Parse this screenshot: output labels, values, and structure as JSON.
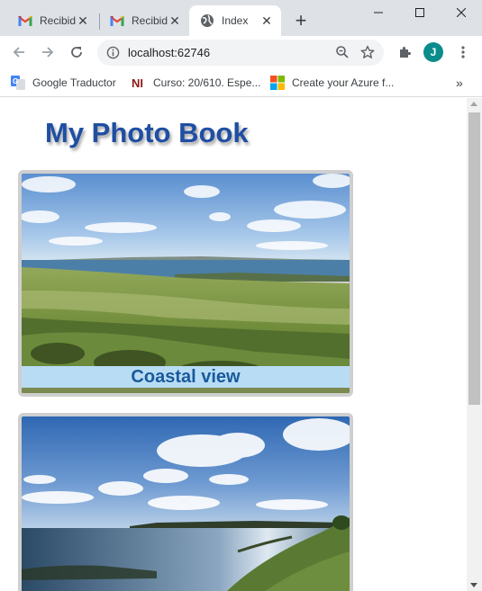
{
  "browser": {
    "tabs": [
      {
        "title": "Recibid",
        "icon": "gmail-icon"
      },
      {
        "title": "Recibid",
        "icon": "gmail-icon"
      },
      {
        "title": "Index",
        "icon": "globe-icon",
        "active": true
      }
    ],
    "address": "localhost:62746",
    "profile_initial": "J",
    "bookmarks": [
      {
        "label": "Google Traductor",
        "icon": "google-translate-icon"
      },
      {
        "label": "Curso: 20/610. Espe...",
        "icon": "ni-logo-icon"
      },
      {
        "label": "Create your Azure f...",
        "icon": "microsoft-logo-icon"
      }
    ],
    "colors": {
      "tabstrip": "#dee1e6",
      "avatar": "#0b8c8c"
    }
  },
  "page": {
    "heading": "My Photo Book",
    "heading_color": "#1f4ea3",
    "photos": [
      {
        "caption": "Coastal view",
        "scene": "coastal-fields"
      },
      {
        "caption": "",
        "scene": "sea-cliff"
      }
    ]
  }
}
